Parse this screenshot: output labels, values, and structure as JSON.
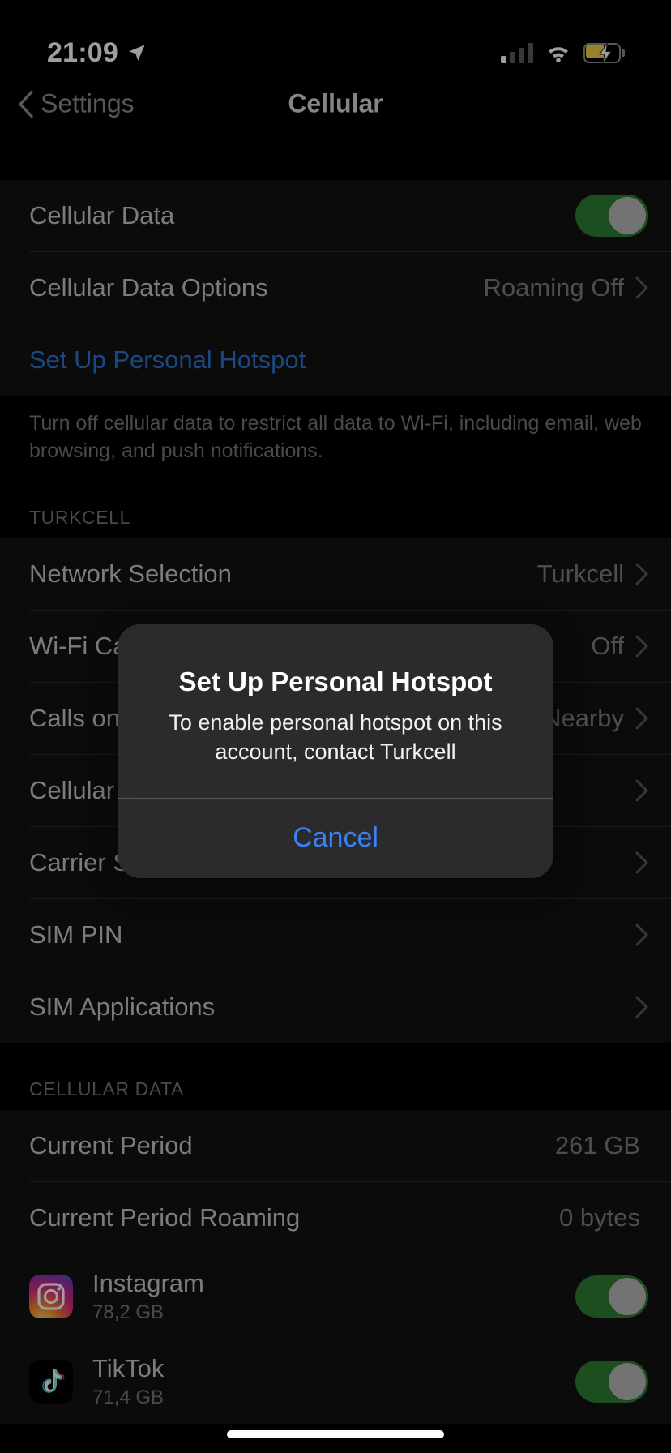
{
  "status_bar": {
    "time": "21:09",
    "location_icon": "location-arrow-icon",
    "signal_icon": "cellular-signal-icon",
    "signal_bars_active": 1,
    "signal_bars_total": 4,
    "wifi_icon": "wifi-icon",
    "battery_icon": "battery-charging-icon",
    "battery_low_power_color": "#f7cf46"
  },
  "nav": {
    "back_label": "Settings",
    "back_icon": "chevron-left-icon",
    "title": "Cellular"
  },
  "group_data": {
    "rows": [
      {
        "label": "Cellular Data",
        "control": "toggle",
        "toggle_on": true
      },
      {
        "label": "Cellular Data Options",
        "value": "Roaming Off",
        "control": "chevron"
      },
      {
        "label": "Set Up Personal Hotspot",
        "style": "link",
        "control": "none"
      }
    ],
    "footer": "Turn off cellular data to restrict all data to Wi-Fi, including email, web browsing, and push notifications."
  },
  "group_carrier": {
    "header": "TURKCELL",
    "rows": [
      {
        "label": "Network Selection",
        "value": "Turkcell",
        "control": "chevron"
      },
      {
        "label": "Wi-Fi Calling",
        "value": "Off",
        "control": "chevron"
      },
      {
        "label": "Calls on Other Devices",
        "value": "When Nearby",
        "control": "chevron"
      },
      {
        "label": "Cellular Data Network",
        "value": "",
        "control": "chevron"
      },
      {
        "label": "Carrier Services",
        "value": "",
        "control": "chevron"
      },
      {
        "label": "SIM PIN",
        "value": "",
        "control": "chevron"
      },
      {
        "label": "SIM Applications",
        "value": "",
        "control": "chevron"
      }
    ]
  },
  "group_usage": {
    "header": "CELLULAR DATA",
    "rows": [
      {
        "label": "Current Period",
        "value": "261 GB"
      },
      {
        "label": "Current Period Roaming",
        "value": "0 bytes"
      }
    ],
    "apps": [
      {
        "name": "Instagram",
        "size": "78,2 GB",
        "icon": "instagram-icon",
        "toggle_on": true
      },
      {
        "name": "TikTok",
        "size": "71,4 GB",
        "icon": "tiktok-icon",
        "toggle_on": true
      }
    ]
  },
  "alert": {
    "title": "Set Up Personal Hotspot",
    "message": "To enable personal hotspot on this account, contact Turkcell",
    "cancel_label": "Cancel",
    "accent_color": "#3b82f6"
  },
  "colors": {
    "background": "#000000",
    "cell_background": "#121212",
    "separator": "#2a2a2a",
    "primary_text": "#c8c8c8",
    "secondary_text": "#7e7e82",
    "link_blue": "#2b74d4",
    "toggle_on": "#2f7d32"
  }
}
